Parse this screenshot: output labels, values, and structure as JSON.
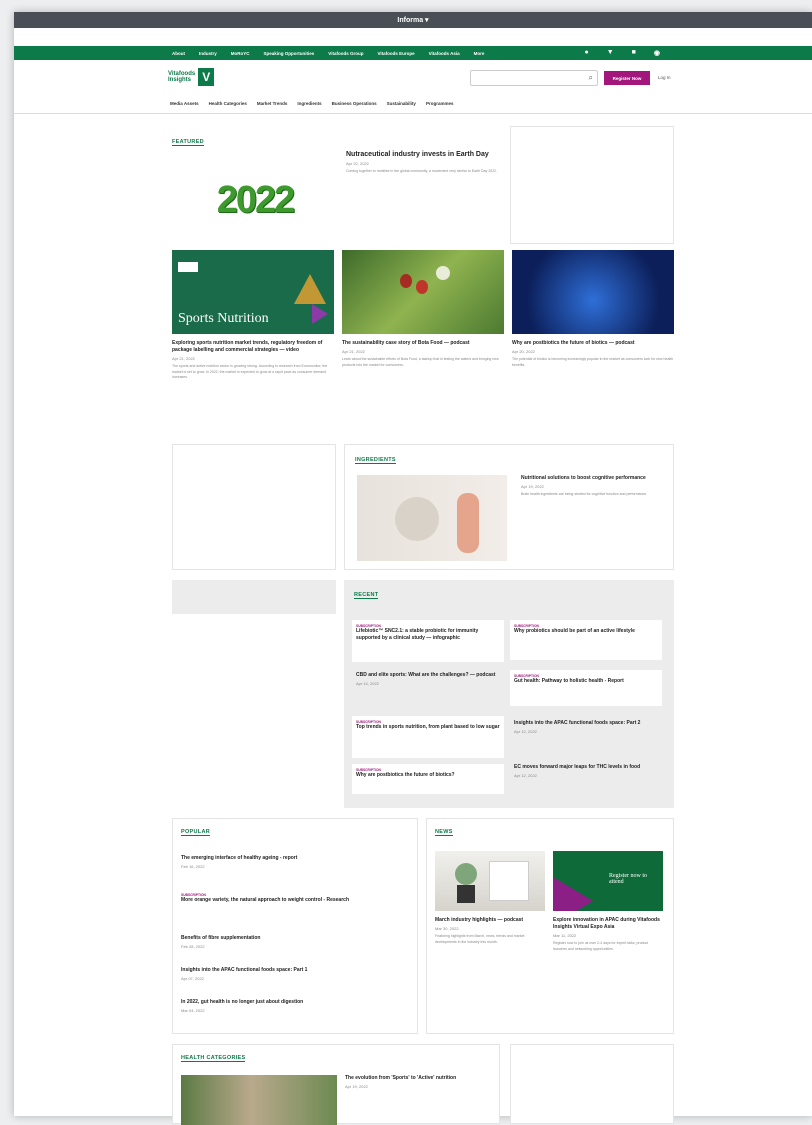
{
  "browser": {
    "title": "Informa"
  },
  "nav": {
    "items": [
      "About",
      "Industry",
      "MoRoYC",
      "Speaking Opportunities",
      "Vitafoods Group",
      "Vitafoods Europe",
      "Vitafoods Asia",
      "More"
    ]
  },
  "header": {
    "logo_line1": "Vitafoods",
    "logo_line2": "Insights",
    "logo_mark": "V",
    "register": "Register Now",
    "login": "Log In"
  },
  "subnav": {
    "items": [
      "Media Assets",
      "Health Categories",
      "Market Trends",
      "Ingredients",
      "Business Operations",
      "Sustainability",
      "Programmes"
    ]
  },
  "featured": {
    "label": "FEATURED",
    "image_text": "2022",
    "title": "Nutraceutical industry invests in Earth Day",
    "date": "Apr 22, 2022",
    "excerpt": "Coming together to mobilise in the global community, a movement very similar to Earth Day 2022."
  },
  "cards": [
    {
      "title": "Exploring sports nutrition market trends, regulatory freedom of package labelling and commercial strategies — video",
      "date": "Apr 21, 2022",
      "img_text": "Sports Nutrition",
      "excerpt": "The sports and active nutrition sector is growing strong. According to research from Euromonitor, the market is set to grow. In 2022, the market is expected to grow at a rapid pace as consumer demand increases."
    },
    {
      "title": "The sustainability case story of Bota Food — podcast",
      "date": "Apr 21, 2022",
      "excerpt": "Learn about the sustainable efforts of Bota Food, a startup that is testing the waters and bringing new products into the market for consumers."
    },
    {
      "title": "Why are postbiotics the future of biotics — podcast",
      "date": "Apr 20, 2022",
      "excerpt": "The potential of biotics is becoming increasingly popular in the market as consumers look for new health benefits."
    }
  ],
  "ingredients": {
    "label": "INGREDIENTS",
    "title": "Nutritional solutions to boost cognitive performance",
    "date": "Apr 19, 2022",
    "excerpt": "Brain health ingredients are being studied for cognitive function and performance."
  },
  "recent": {
    "label": "RECENT",
    "items": [
      {
        "tag": "SUBSCRIPTION",
        "title": "Lifebiotic™ SNC2.1: a stable probiotic for immunity supported by a clinical study — infographic",
        "date": ""
      },
      {
        "tag": "SUBSCRIPTION",
        "title": "Why probiotics should be part of an active lifestyle",
        "date": ""
      },
      {
        "tag": "",
        "title": "CBD and elite sports: What are the challenges? — podcast",
        "date": "Apr 14, 2022"
      },
      {
        "tag": "SUBSCRIPTION",
        "title": "Gut health: Pathway to holistic health - Report",
        "date": ""
      },
      {
        "tag": "SUBSCRIPTION",
        "title": "Top trends in sports nutrition, from plant based to low sugar",
        "date": ""
      },
      {
        "tag": "",
        "title": "Insights into the APAC functional foods space: Part 2",
        "date": "Apr 12, 2022"
      },
      {
        "tag": "SUBSCRIPTION",
        "title": "Why are postbiotics the future of biotics?",
        "date": ""
      },
      {
        "tag": "",
        "title": "EC moves forward major leaps for THC levels in food",
        "date": "Apr 12, 2022"
      }
    ]
  },
  "popular": {
    "label": "POPULAR",
    "items": [
      {
        "tag": "",
        "title": "The emerging interface of healthy ageing - report",
        "date": "Feb 16, 2022"
      },
      {
        "tag": "SUBSCRIPTION",
        "title": "More orange variety, the natural approach to weight control - Research",
        "date": ""
      },
      {
        "tag": "",
        "title": "Benefits of fibre supplementation",
        "date": "Feb 28, 2022"
      },
      {
        "tag": "",
        "title": "Insights into the APAC functional foods space: Part 1",
        "date": "Apr 07, 2022"
      },
      {
        "tag": "",
        "title": "In 2022, gut health is no longer just about digestion",
        "date": "Mar 04, 2022"
      }
    ]
  },
  "news": {
    "label": "NEWS",
    "items": [
      {
        "title": "March industry highlights — podcast",
        "date": "Mar 30, 2022",
        "excerpt": "Featuring highlights from March, news, trends and market developments in the industry this month."
      },
      {
        "title": "Explore innovation in APAC during Vitafoods Insights Virtual Expo Asia",
        "date": "Mar 11, 2022",
        "img_text": "Register now to attend",
        "excerpt": "Register now to join us over 2-4 days for expert talks, product launches and networking opportunities."
      }
    ]
  },
  "health": {
    "label": "HEALTH CATEGORIES",
    "title": "The evolution from 'Sports' to 'Active' nutrition",
    "date": "Apr 19, 2022"
  },
  "colors": {
    "brand": "#0d7a4a",
    "accent": "#a3167b"
  }
}
